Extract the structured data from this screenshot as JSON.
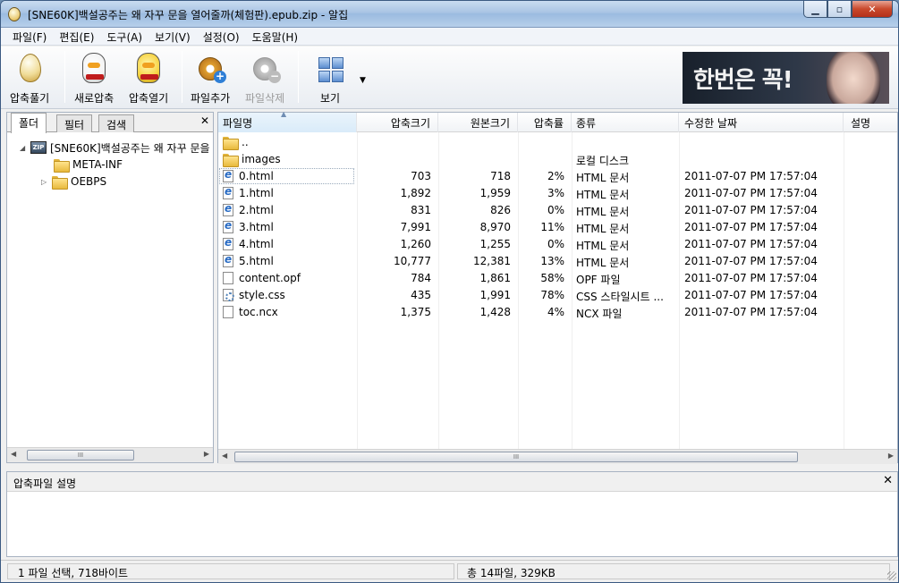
{
  "window": {
    "title": "[SNE60K]백설공주는 왜 자꾸 문을 열어줄까(체험판).epub.zip - 알집",
    "minimize": "▁",
    "maximize": "▫",
    "close": "✕"
  },
  "menu": [
    "파일(F)",
    "편집(E)",
    "도구(A)",
    "보기(V)",
    "설정(O)",
    "도움말(H)"
  ],
  "toolbar": {
    "extract": "압축풀기",
    "new_archive": "새로압축",
    "open_archive": "압축열기",
    "add_file": "파일추가",
    "delete_file": "파일삭제",
    "view": "보기"
  },
  "banner": {
    "text": "한번은 꼭!"
  },
  "left_pane": {
    "tabs": [
      "폴더",
      "필터",
      "검색"
    ],
    "close": "✕",
    "tree": [
      {
        "label": "[SNE60K]백설공주는 왜 자꾸 문을",
        "expander": "◢",
        "icon": "zip-icon"
      },
      {
        "label": "META-INF",
        "expander": "",
        "icon": "folder-icon"
      },
      {
        "label": "OEBPS",
        "expander": "▷",
        "icon": "folder-icon"
      }
    ],
    "scroll_thumb": "III"
  },
  "file_list": {
    "columns": [
      "파일명",
      "압축크기",
      "원본크기",
      "압축률",
      "종류",
      "수정한 날짜",
      "설명"
    ],
    "rows": [
      {
        "name": "..",
        "icon": "folder",
        "packed": "",
        "size": "",
        "ratio": "",
        "type": "",
        "date": ""
      },
      {
        "name": "images",
        "icon": "folder",
        "packed": "",
        "size": "",
        "ratio": "",
        "type": "로컬 디스크",
        "date": ""
      },
      {
        "name": "0.html",
        "icon": "html",
        "packed": "703",
        "size": "718",
        "ratio": "2%",
        "type": "HTML 문서",
        "date": "2011-07-07 PM 17:57:04"
      },
      {
        "name": "1.html",
        "icon": "html",
        "packed": "1,892",
        "size": "1,959",
        "ratio": "3%",
        "type": "HTML 문서",
        "date": "2011-07-07 PM 17:57:04"
      },
      {
        "name": "2.html",
        "icon": "html",
        "packed": "831",
        "size": "826",
        "ratio": "0%",
        "type": "HTML 문서",
        "date": "2011-07-07 PM 17:57:04"
      },
      {
        "name": "3.html",
        "icon": "html",
        "packed": "7,991",
        "size": "8,970",
        "ratio": "11%",
        "type": "HTML 문서",
        "date": "2011-07-07 PM 17:57:04"
      },
      {
        "name": "4.html",
        "icon": "html",
        "packed": "1,260",
        "size": "1,255",
        "ratio": "0%",
        "type": "HTML 문서",
        "date": "2011-07-07 PM 17:57:04"
      },
      {
        "name": "5.html",
        "icon": "html",
        "packed": "10,777",
        "size": "12,381",
        "ratio": "13%",
        "type": "HTML 문서",
        "date": "2011-07-07 PM 17:57:04"
      },
      {
        "name": "content.opf",
        "icon": "file",
        "packed": "784",
        "size": "1,861",
        "ratio": "58%",
        "type": "OPF 파일",
        "date": "2011-07-07 PM 17:57:04"
      },
      {
        "name": "style.css",
        "icon": "css",
        "packed": "435",
        "size": "1,991",
        "ratio": "78%",
        "type": "CSS 스타일시트 ...",
        "date": "2011-07-07 PM 17:57:04"
      },
      {
        "name": "toc.ncx",
        "icon": "file",
        "packed": "1,375",
        "size": "1,428",
        "ratio": "4%",
        "type": "NCX 파일",
        "date": "2011-07-07 PM 17:57:04"
      }
    ],
    "scroll_thumb": "III"
  },
  "description_pane": {
    "title": "압축파일 설명",
    "close": "✕"
  },
  "status": {
    "selection": "1 파일 선택,  718바이트",
    "total": "총 14파일,  329KB"
  },
  "colors": {
    "title_bar": "#a9c4e4",
    "selection_border": "#9ab",
    "folder": "#e8b93c"
  }
}
